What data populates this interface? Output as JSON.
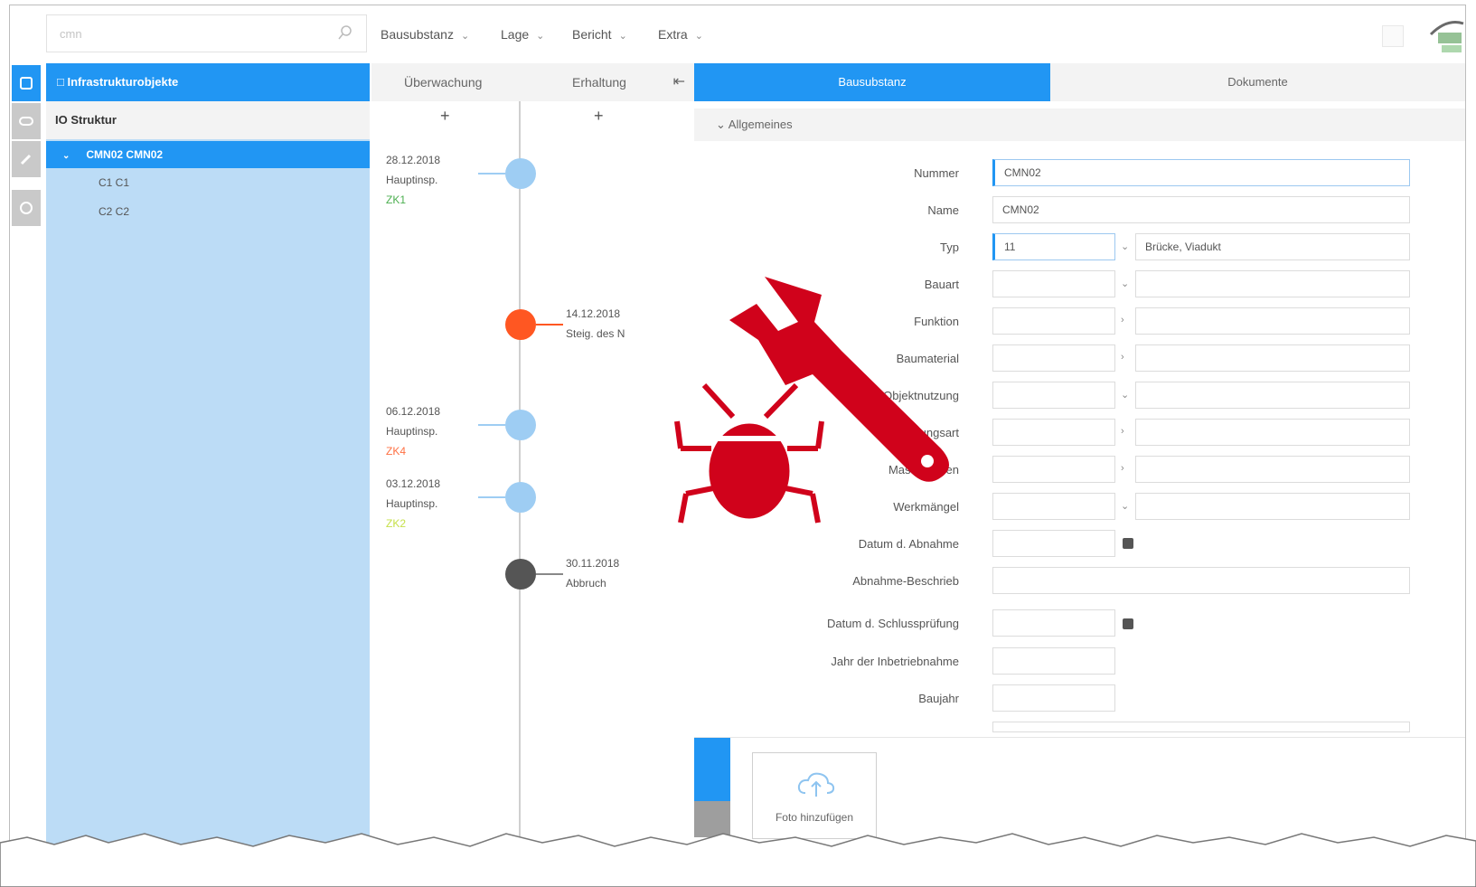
{
  "topbar": {
    "search_placeholder": "cmn",
    "menus": [
      "Bausubstanz",
      "Lage",
      "Bericht",
      "Extra"
    ]
  },
  "tree": {
    "header": "Infrastrukturobjekte",
    "subheader": "IO Struktur",
    "selected": "CMN02 CMN02",
    "children": [
      "C1 C1",
      "C2 C2"
    ]
  },
  "timeline": {
    "tabs": [
      "Überwachung",
      "Erhaltung"
    ],
    "add_symbol": "+",
    "events": [
      {
        "date": "28.12.2018",
        "type": "Hauptinsp.",
        "status": "ZK1",
        "status_color": "#4caf50"
      },
      {
        "date": "14.12.2018",
        "type": "Steig. des N"
      },
      {
        "date": "06.12.2018",
        "type": "Hauptinsp.",
        "status": "ZK4",
        "status_color": "#ff7043"
      },
      {
        "date": "03.12.2018",
        "type": "Hauptinsp.",
        "status": "ZK2",
        "status_color": "#c6e04a"
      },
      {
        "date": "30.11.2018",
        "type": "Abbruch"
      }
    ]
  },
  "detail": {
    "tabs": [
      "Bausubstanz",
      "Dokumente"
    ],
    "section": "Allgemeines",
    "fields": {
      "nummer": {
        "label": "Nummer",
        "value": "CMN02"
      },
      "name": {
        "label": "Name",
        "value": "CMN02"
      },
      "typ": {
        "label": "Typ",
        "code": "11",
        "text": "Brücke, Viadukt"
      },
      "bauart": {
        "label": "Bauart"
      },
      "funktion": {
        "label": "Funktion"
      },
      "baumaterial": {
        "label": "Baumaterial"
      },
      "objektnutzung": {
        "label": "Objektnutzung"
      },
      "gruendungsart": {
        "label": "Gründungsart"
      },
      "massnahmen": {
        "label": "Massnahmen"
      },
      "werkmaengel": {
        "label": "Werkmängel"
      },
      "datum_abnahme": {
        "label": "Datum d. Abnahme"
      },
      "abnahme_beschrieb": {
        "label": "Abnahme-Beschrieb"
      },
      "datum_schluss": {
        "label": "Datum d. Schlussprüfung"
      },
      "jahr_inbetrieb": {
        "label": "Jahr der Inbetriebnahme"
      },
      "baujahr": {
        "label": "Baujahr"
      }
    },
    "photo_button": "Foto hinzufügen"
  },
  "colors": {
    "accent": "#2196f3",
    "tree_bg": "#bcdcf6",
    "overlay_red": "#d0021b",
    "inspection_node": "#9ecdf3",
    "maintenance_node": "#ff5722",
    "demolish_node": "#555555"
  },
  "icons": [
    "search-icon",
    "chevron-down-icon",
    "bug-icon",
    "wrench-icon",
    "cloud-upload-icon",
    "eye-icon",
    "calendar-icon"
  ]
}
